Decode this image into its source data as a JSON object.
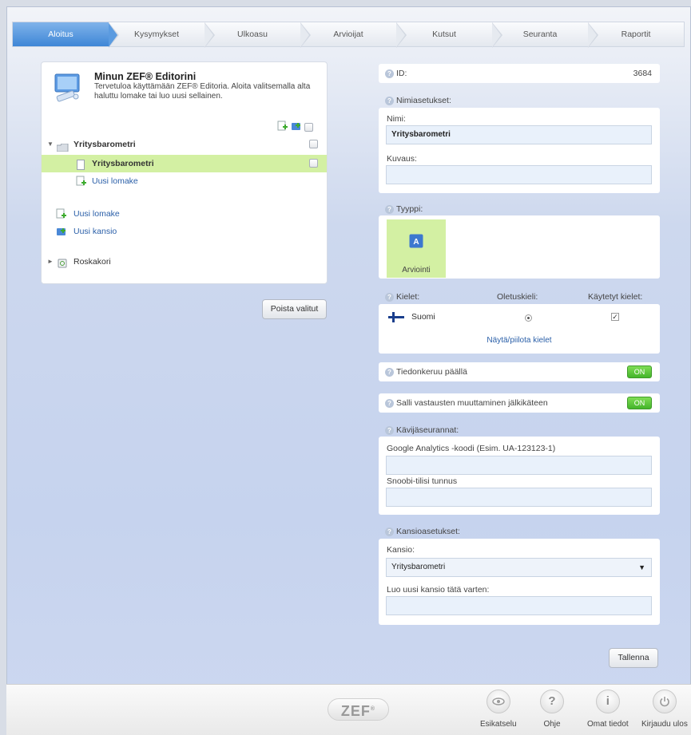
{
  "tabs": [
    {
      "label": "Aloitus",
      "active": true
    },
    {
      "label": "Kysymykset",
      "active": false
    },
    {
      "label": "Ulkoasu",
      "active": false
    },
    {
      "label": "Arvioijat",
      "active": false
    },
    {
      "label": "Kutsut",
      "active": false
    },
    {
      "label": "Seuranta",
      "active": false
    },
    {
      "label": "Raportit",
      "active": false
    }
  ],
  "left": {
    "title": "Minun ZEF® Editorini",
    "intro": "Tervetuloa käyttämään ZEF® Editoria. Aloita valitsemalla alta haluttu lomake tai luo uusi sellainen.",
    "tree": {
      "folder": "Yritysbarometri",
      "selected_form": "Yritysbarometri",
      "new_form_inside": "Uusi lomake"
    },
    "new_form": "Uusi lomake",
    "new_folder": "Uusi kansio",
    "trash": "Roskakori",
    "delete_button": "Poista valitut"
  },
  "right": {
    "id_label": "ID:",
    "id_value": "3684",
    "naming_label": "Nimiasetukset:",
    "name_label": "Nimi:",
    "name_value": "Yritysbarometri",
    "description_label": "Kuvaus:",
    "description_value": "",
    "type_label": "Tyyppi:",
    "type_value": "Arviointi",
    "languages_label": "Kielet:",
    "default_language_label": "Oletuskieli:",
    "used_languages_label": "Käytetyt kielet:",
    "language": "Suomi",
    "show_hide_languages": "Näytä/piilota kielet",
    "data_collection_label": "Tiedonkeruu päällä",
    "data_collection_state": "ON",
    "allow_edit_label": "Salli vastausten muuttaminen jälkikäteen",
    "allow_edit_state": "ON",
    "tracking_label": "Kävijäseurannat:",
    "ga_label": "Google Analytics -koodi (Esim. UA-123123-1)",
    "ga_value": "",
    "snoobi_label": "Snoobi-tilisi tunnus",
    "snoobi_value": "",
    "folder_settings_label": "Kansioasetukset:",
    "folder_label": "Kansio:",
    "folder_value": "Yritysbarometri",
    "new_folder_label": "Luo uusi kansio tätä varten:",
    "new_folder_value": "",
    "save_button": "Tallenna"
  },
  "footer": {
    "logo": "ZEF",
    "buttons": [
      {
        "label": "Esikatselu",
        "icon": "eye-icon"
      },
      {
        "label": "Ohje",
        "icon": "question-icon"
      },
      {
        "label": "Omat tiedot",
        "icon": "info-icon"
      },
      {
        "label": "Kirjaudu ulos",
        "icon": "power-icon"
      }
    ]
  },
  "colors": {
    "active_tab": "#4a8fdc",
    "selected_row": "#d3f0a3",
    "toggle_on": "#55c03a",
    "link": "#2a5fa8"
  }
}
